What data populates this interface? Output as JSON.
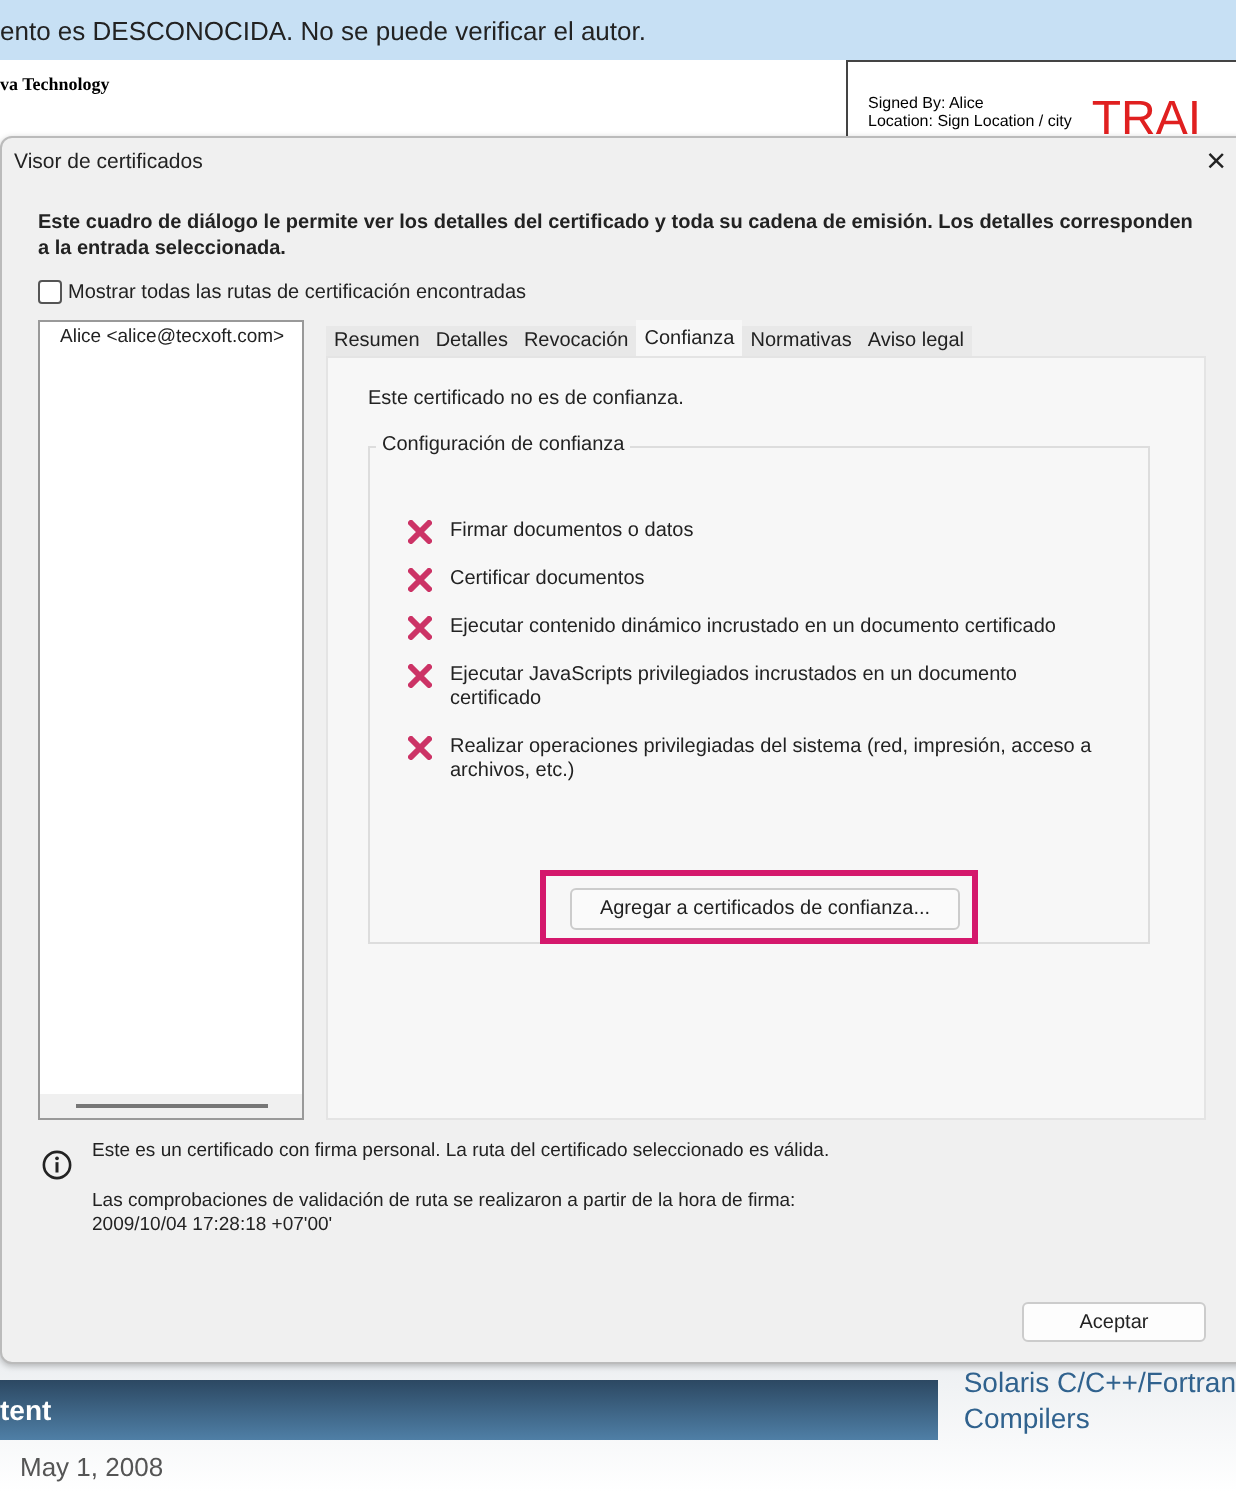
{
  "background_page": {
    "info_bar": "ento es DESCONOCIDA. No se puede verificar el autor.",
    "site_title": "va Technology",
    "signature": {
      "lines": [
        "Signed By: Alice",
        "Location: Sign Location / city"
      ],
      "stamp": "TRAI"
    },
    "content_header": "tent",
    "date": "May 1, 2008",
    "side_links": [
      "Solaris C/C++/Fortran",
      "Compilers"
    ]
  },
  "window": {
    "title": "Visor de certificados",
    "close": "×"
  },
  "description": "Este cuadro de diálogo le permite ver los detalles del certificado y toda su cadena de emisión. Los detalles corresponden a la entrada seleccionada.",
  "show_all_paths": {
    "label": "Mostrar todas las rutas de certificación encontradas",
    "checked": false
  },
  "certificate_list": [
    "Alice <alice@tecxoft.com>"
  ],
  "tabs": [
    {
      "label": "Resumen",
      "selected": false
    },
    {
      "label": "Detalles",
      "selected": false
    },
    {
      "label": "Revocación",
      "selected": false
    },
    {
      "label": "Confianza",
      "selected": true
    },
    {
      "label": "Normativas",
      "selected": false
    },
    {
      "label": "Aviso legal",
      "selected": false
    }
  ],
  "trust_status": "Este certificado no es de confianza.",
  "trust_group": {
    "title": "Configuración de confianza",
    "items": [
      {
        "label": "Firmar documentos o datos",
        "allowed": false
      },
      {
        "label": "Certificar documentos",
        "allowed": false
      },
      {
        "label": "Ejecutar contenido dinámico incrustado en un documento certificado",
        "allowed": false
      },
      {
        "label": "Ejecutar JavaScripts privilegiados incrustados en un documento certificado",
        "allowed": false
      },
      {
        "label": "Realizar operaciones privilegiadas del sistema (red, impresión, acceso a archivos, etc.)",
        "allowed": false
      }
    ],
    "add_button": {
      "label": "Agregar a certificados de confianza...",
      "highlighted": true
    }
  },
  "info": {
    "lines": [
      "Este es un certificado con firma personal. La ruta del certificado seleccionado es válida.",
      "Las comprobaciones de validación de ruta se realizaron a partir de la hora de firma:",
      "2009/10/04 17:28:18 +07'00'"
    ]
  },
  "buttons": [
    "Aceptar"
  ]
}
